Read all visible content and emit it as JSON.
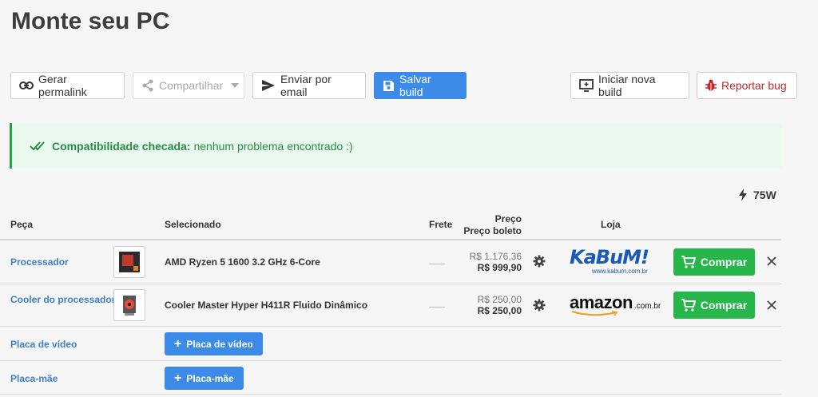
{
  "page": {
    "title": "Monte seu PC"
  },
  "toolbar": {
    "permalink": "Gerar permalink",
    "share": "Compartilhar",
    "email": "Enviar por email",
    "save": "Salvar build",
    "new_build": "Iniciar nova build",
    "report_bug": "Reportar bug"
  },
  "alert": {
    "strong": "Compatibilidade checada:",
    "text": "nenhum problema encontrado :)"
  },
  "wattage": "75W",
  "table": {
    "headers": {
      "part": "Peça",
      "selected": "Selecionado",
      "shipping": "Frete",
      "price": "Preço",
      "price_boleto": "Preço boleto",
      "store": "Loja"
    },
    "rows": [
      {
        "part": "Processador",
        "product": "AMD Ryzen 5 1600 3.2 GHz 6-Core",
        "price": "R$ 1.176,36",
        "price_boleto": "R$ 999,90",
        "store": "KaBuM!",
        "store_sub": "www.kabum.com.br",
        "buy": "Comprar"
      },
      {
        "part": "Cooler do processador",
        "product": "Cooler Master Hyper H411R Fluido Dinâmico",
        "price": "R$ 250,00",
        "price_boleto": "R$ 250,00",
        "store": "amazon",
        "store_sub": ".com.br",
        "buy": "Comprar"
      }
    ],
    "empty_rows": [
      {
        "part": "Placa de vídeo",
        "button": "Placa de vídeo"
      },
      {
        "part": "Placa-mãe",
        "button": "Placa-mãe"
      }
    ]
  },
  "colors": {
    "primary": "#3d8be8",
    "buy": "#27b64a",
    "alert_bg": "#e9f9ee",
    "alert_text": "#2a8a48",
    "link": "#3d7fc8",
    "bug": "#c0282b"
  }
}
